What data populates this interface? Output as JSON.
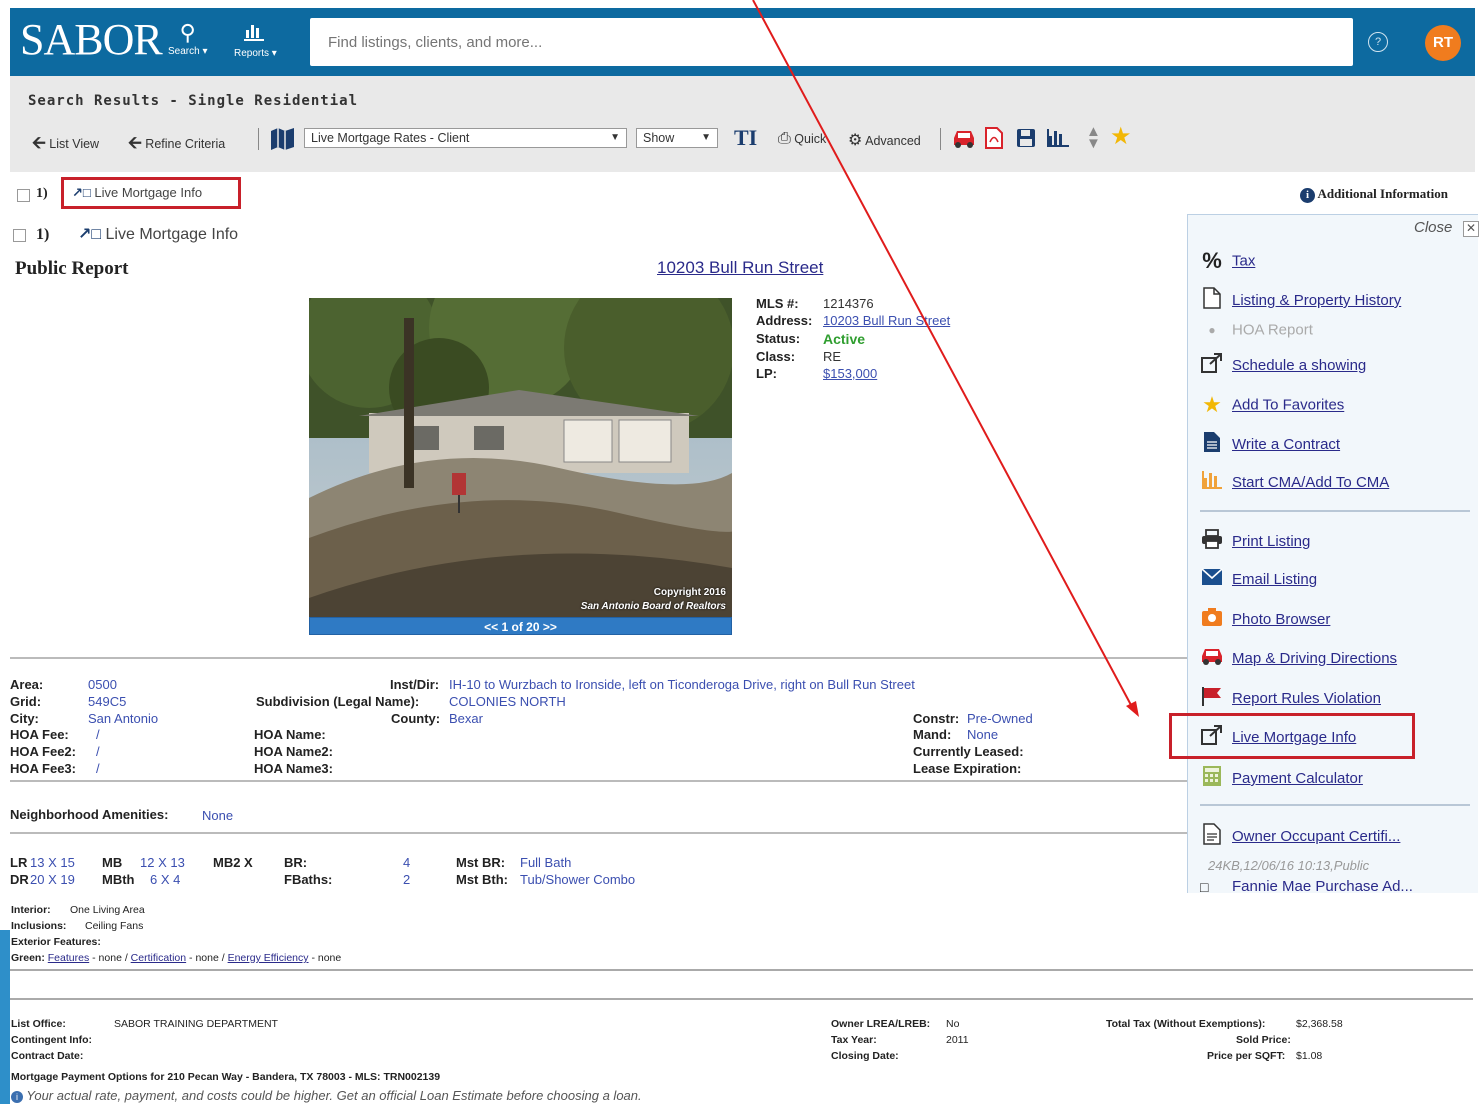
{
  "header": {
    "logo": "SABOR",
    "nav": [
      {
        "label": "Search ▾",
        "icon": "search-icon"
      },
      {
        "label": "Reports ▾",
        "icon": "bar-chart-icon"
      }
    ],
    "search_placeholder": "Find listings, clients, and more...",
    "help_icon": "?",
    "avatar_initials": "RT"
  },
  "toolbar": {
    "title": "Search Results - Single Residential",
    "list_view": "List View",
    "refine_criteria": "Refine Criteria",
    "report_select": "Live Mortgage Rates - Client",
    "show_select": "Show",
    "quick": "Quick",
    "advanced": "Advanced"
  },
  "results": {
    "row1_num": "1)",
    "row1_link": "Live Mortgage Info",
    "row2_num": "1)",
    "row2_link": "Live Mortgage Info",
    "additional_info": "Additional Information"
  },
  "report": {
    "title": "Public Report",
    "address_title": "10203 Bull Run Street",
    "mls_label": "MLS #:",
    "mls_value": "1214376",
    "address_label": "Address:",
    "address_value": "10203 Bull Run Street",
    "status_label": "Status:",
    "status_value": "Active",
    "class_label": "Class:",
    "class_value": "RE",
    "lp_label": "LP:",
    "lp_value": "$153,000",
    "photo_caption_1": "Copyright 2016",
    "photo_caption_2": "San Antonio Board of Realtors",
    "photo_nav": "<< 1 of 20 >>",
    "area_label": "Area:",
    "area_value": "0500",
    "grid_label": "Grid:",
    "grid_value": "549C5",
    "city_label": "City:",
    "city_value": "San Antonio",
    "hoa_fee_label": "HOA Fee:",
    "hoa_fee_value": "/",
    "hoa_fee2_label": "HOA Fee2:",
    "hoa_fee2_value": "/",
    "hoa_fee3_label": "HOA Fee3:",
    "hoa_fee3_value": "/",
    "instdir_label": "Inst/Dir:",
    "instdir_value": "IH-10 to Wurzbach to Ironside, left on Ticonderoga Drive, right on Bull Run Street",
    "subdivision_label": "Subdivision (Legal Name):",
    "subdivision_value": "COLONIES NORTH",
    "county_label": "County:",
    "county_value": "Bexar",
    "hoa_name_label": "HOA Name:",
    "hoa_name2_label": "HOA Name2:",
    "hoa_name3_label": "HOA Name3:",
    "constr_label": "Constr:",
    "constr_value": "Pre-Owned",
    "mand_label": "Mand:",
    "mand_value": "None",
    "leased_label": "Currently Leased:",
    "lease_exp_label": "Lease Expiration:",
    "amenities_label": "Neighborhood Amenities:",
    "amenities_value": "None",
    "lr_label": "LR",
    "lr_value": "13 X 15",
    "dr_label": "DR",
    "dr_value": "20 X 19",
    "mb_label": "MB",
    "mb_value": "12 X 13",
    "mbth_label": "MBth",
    "mbth_value": "6 X 4",
    "mb2_label": "MB2 X",
    "br_label": "BR:",
    "br_value": "4",
    "fbaths_label": "FBaths:",
    "fbaths_value": "2",
    "mstbr_label": "Mst BR:",
    "mstbr_value": "Full Bath",
    "mstbth_label": "Mst Bth:",
    "mstbth_value": "Tub/Shower Combo"
  },
  "panel": {
    "close": "Close",
    "items": [
      {
        "label": "Tax",
        "icon": "percent-icon"
      },
      {
        "label": "Listing & Property History",
        "icon": "document-icon"
      },
      {
        "label": "HOA Report",
        "icon": "dot-icon"
      },
      {
        "label": "Schedule a showing",
        "icon": "external-link-icon"
      },
      {
        "label": "Add To Favorites",
        "icon": "star-icon"
      },
      {
        "label": "Write a Contract",
        "icon": "file-icon"
      },
      {
        "label": "Start CMA/Add To CMA",
        "icon": "bar-chart-icon"
      },
      {
        "label": "Print Listing",
        "icon": "print-icon"
      },
      {
        "label": "Email Listing",
        "icon": "envelope-icon"
      },
      {
        "label": "Photo Browser",
        "icon": "camera-icon"
      },
      {
        "label": "Map & Driving Directions",
        "icon": "car-icon"
      },
      {
        "label": "Report Rules Violation",
        "icon": "flag-icon"
      },
      {
        "label": "Live Mortgage Info",
        "icon": "external-link-icon"
      },
      {
        "label": "Payment Calculator",
        "icon": "calculator-icon"
      },
      {
        "label": "Owner Occupant Certifi...",
        "icon": "document-icon"
      }
    ],
    "file_meta": "24KB,12/06/16 10:13,Public",
    "partial_item": "Fannie Mae Purchase Ad..."
  },
  "lower": {
    "interior_label": "Interior:",
    "interior_value": "One Living Area",
    "inclusions_label": "Inclusions:",
    "inclusions_value": "Ceiling Fans",
    "exterior_label": "Exterior Features:",
    "green_label": "Green:",
    "green_features": "Features",
    "green_certification": "Certification",
    "green_energy": "Energy Efficiency",
    "green_none": "none",
    "list_office_label": "List Office:",
    "list_office_value": "SABOR TRAINING DEPARTMENT",
    "contingent_label": "Contingent Info:",
    "contract_label": "Contract Date:",
    "owner_label": "Owner LREA/LREB:",
    "owner_value": "No",
    "taxyear_label": "Tax Year:",
    "taxyear_value": "2011",
    "closing_label": "Closing Date:",
    "totaltax_label": "Total Tax (Without Exemptions):",
    "totaltax_value": "$2,368.58",
    "sold_label": "Sold Price:",
    "psf_label": "Price per SQFT:",
    "psf_value": "$1.08",
    "mortgage_heading": "Mortgage Payment Options for 210 Pecan Way - Bandera, TX 78003 - MLS: TRN002139",
    "disclaimer": "Your actual rate, payment, and costs could be higher. Get an official Loan Estimate before choosing a loan."
  },
  "colors": {
    "header": "#0d6aa0",
    "accent_orange": "#f07c1e",
    "highlight_red": "#c8202a",
    "link": "#2a2a8a",
    "panel_bg": "#f2f7fb"
  }
}
